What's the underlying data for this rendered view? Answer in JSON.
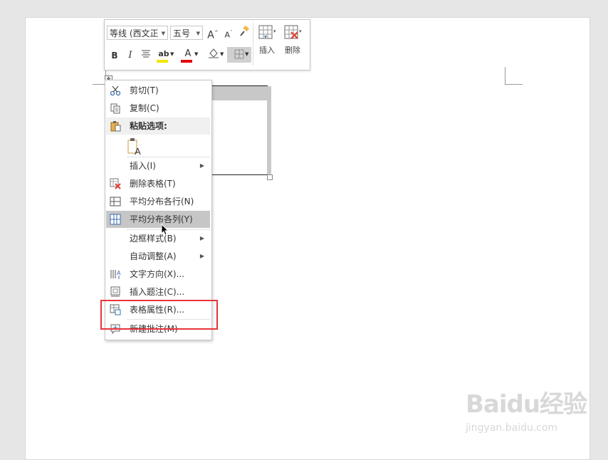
{
  "toolbar": {
    "font_name": "等线 (西文正",
    "font_size": "五号",
    "grow_font": "A",
    "shrink_font": "A",
    "bold": "B",
    "italic": "I",
    "highlight": "ab",
    "font_color": "A",
    "insert_label": "插入",
    "delete_label": "删除"
  },
  "context_menu": {
    "cut": "剪切(T)",
    "copy": "复制(C)",
    "paste_options": "粘贴选项:",
    "insert": "插入(I)",
    "delete_table": "删除表格(T)",
    "distribute_rows": "平均分布各行(N)",
    "distribute_cols": "平均分布各列(Y)",
    "border_styles": "边框样式(B)",
    "autofit": "自动调整(A)",
    "text_direction": "文字方向(X)...",
    "insert_caption": "插入题注(C)...",
    "table_properties": "表格属性(R)...",
    "new_comment": "新建批注(M)"
  },
  "watermark": {
    "brand": "Baidu经验",
    "url": "jingyan.baidu.com"
  },
  "colors": {
    "highlight_bar": "#f2e600",
    "font_color_bar": "#e3000f",
    "annotation_box": "#e8343b",
    "selection": "#c6c6c6"
  },
  "icons": [
    "scissors-icon",
    "copy-icon",
    "paste-icon",
    "keep-text-only-icon",
    "delete-table-icon",
    "distribute-rows-icon",
    "distribute-columns-icon",
    "text-direction-icon",
    "caption-icon",
    "table-properties-icon",
    "comment-icon",
    "insert-table-icon",
    "delete-table-icon",
    "format-painter-icon",
    "border-icon",
    "shading-icon",
    "align-center-icon"
  ]
}
